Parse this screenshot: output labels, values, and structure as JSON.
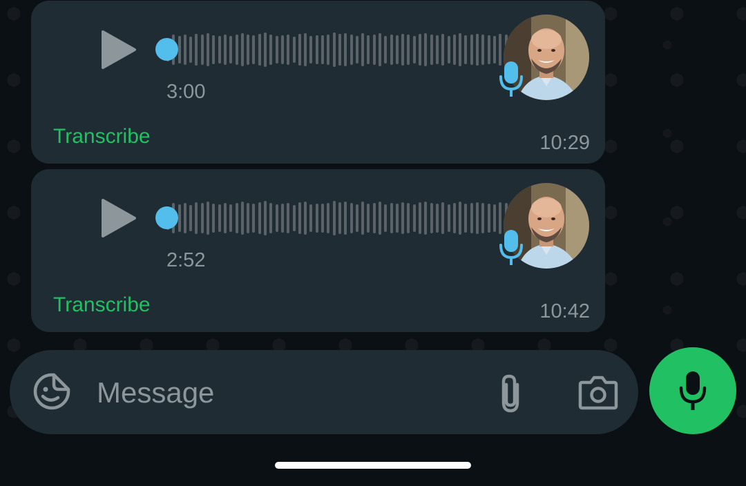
{
  "messages": [
    {
      "duration": "3:00",
      "transcribe_label": "Transcribe",
      "time": "10:29",
      "waveform": [
        34,
        44,
        40,
        44,
        38,
        46,
        44,
        48,
        42,
        40,
        44,
        40,
        44,
        48,
        44,
        42,
        46,
        50,
        44,
        40,
        42,
        44,
        38,
        46,
        48,
        40,
        42,
        42,
        44,
        50,
        46,
        48,
        44,
        40,
        48,
        42,
        44,
        48,
        40,
        44,
        42,
        46,
        44,
        40,
        46,
        48,
        44,
        42,
        46,
        40,
        44,
        48,
        42,
        44,
        46,
        44,
        42,
        40,
        46,
        44
      ]
    },
    {
      "duration": "2:52",
      "transcribe_label": "Transcribe",
      "time": "10:42",
      "waveform": [
        34,
        44,
        40,
        44,
        38,
        46,
        44,
        48,
        42,
        40,
        44,
        40,
        44,
        48,
        44,
        42,
        46,
        50,
        44,
        40,
        42,
        44,
        38,
        46,
        48,
        40,
        42,
        42,
        44,
        50,
        46,
        48,
        44,
        40,
        48,
        42,
        44,
        48,
        40,
        44,
        42,
        46,
        44,
        40,
        46,
        48,
        44,
        42,
        46,
        40,
        44,
        48,
        42,
        44,
        46,
        44,
        42,
        40,
        46,
        44
      ]
    }
  ],
  "composer": {
    "placeholder": "Message"
  },
  "icons": {
    "play": "play-icon",
    "mic_badge": "microphone-icon",
    "sticker": "sticker-icon",
    "attach": "paperclip-icon",
    "camera": "camera-icon",
    "mic": "microphone-icon"
  },
  "colors": {
    "accent_green": "#21c063",
    "scrub_blue": "#53bdeb",
    "bubble": "#1f2c33"
  }
}
